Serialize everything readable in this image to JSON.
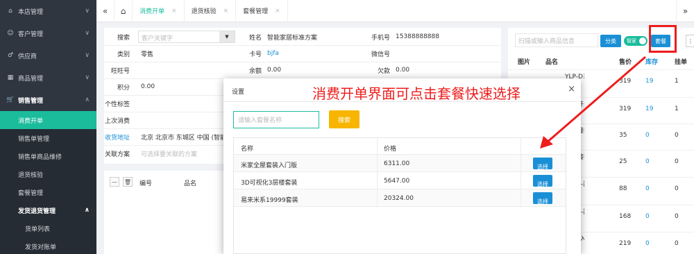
{
  "sidebar": {
    "items": [
      {
        "label": "本店管理",
        "icon": "home-icon"
      },
      {
        "label": "客户管理",
        "icon": "user-icon"
      },
      {
        "label": "供应商",
        "icon": "gender-icon"
      },
      {
        "label": "商品管理",
        "icon": "grid-icon"
      },
      {
        "label": "销售管理",
        "icon": "cart-icon"
      }
    ],
    "sales_sub": [
      "消费开单",
      "销售单管理",
      "销售单商品维修",
      "退货核验",
      "套餐管理",
      "发货退货管理"
    ],
    "ship_sub": [
      "货单列表",
      "发货对账单"
    ]
  },
  "tabs": [
    "消费开单",
    "退货核验",
    "套餐管理"
  ],
  "form": {
    "search_label": "搜索",
    "search_placeholder": "客户关键字",
    "category_label": "类别",
    "category_value": "零售",
    "wangwang_label": "旺旺号",
    "points_label": "积分",
    "points_value": "0.00",
    "tag_label": "个性标签",
    "last_label": "上次消费",
    "address_label": "收货地址",
    "address_value": "北京 北京市 东城区 中国 (智能",
    "plan_label": "关联方案",
    "plan_placeholder": "可选择要关联的方案",
    "name_label": "姓名",
    "name_value": "智能家居标准方案",
    "card_label": "卡号",
    "card_value": "bjfa",
    "balance_label": "余额",
    "balance_value": "0.00",
    "phone_label": "手机号",
    "phone_value": "15388888888",
    "wechat_label": "微信号",
    "debt_label": "欠款",
    "debt_value": "0.00"
  },
  "list_head": {
    "col1": "编号",
    "col2": "品名"
  },
  "right_panel": {
    "search_placeholder": "扫描或输入商品信息",
    "category_btn": "分类",
    "toggle_label": "智家",
    "package_btn": "套餐",
    "headers": {
      "image": "图片",
      "name": "品名",
      "price": "售价",
      "stock": "库存",
      "hang": "挂单"
    },
    "rows": [
      {
        "name": "YLP-D系列智能开关云麒麟",
        "price": "319",
        "stock": "19",
        "hang": "1"
      },
      {
        "name": "智能开关云方版白",
        "price": "319",
        "stock": "19",
        "hang": "1"
      },
      {
        "name": "头连接轨道",
        "price": "35",
        "stock": "0",
        "hang": "0"
      },
      {
        "name": "线连接轨道",
        "price": "25",
        "stock": "0",
        "hang": "0"
      },
      {
        "name": "30FC-器",
        "price": "88",
        "stock": "0",
        "hang": "0"
      },
      {
        "name": "60FC-器",
        "price": "168",
        "stock": "0",
        "hang": "0"
      },
      {
        "name": "能-嵌入光射",
        "price": "219",
        "stock": "0",
        "hang": "0"
      }
    ]
  },
  "modal": {
    "title": "设置",
    "input_placeholder": "请输入套餐名称",
    "search_btn": "搜索",
    "col_name": "名称",
    "col_price": "价格",
    "rows": [
      {
        "name": "米家全屋套装入门版",
        "price": "6311.00",
        "action": "选择"
      },
      {
        "name": "3D可视化3层楼套装",
        "price": "5647.00",
        "action": "选择"
      },
      {
        "name": "易来米系19999套装",
        "price": "20324.00",
        "action": "选择"
      }
    ]
  },
  "annotation": "消费开单界面可点击套餐快速选择",
  "colors": {
    "accent": "#1abc9c",
    "blue": "#1a8fd6",
    "red": "#ee1c1c",
    "yellow": "#f7b500",
    "sidebar": "#2f3640"
  }
}
